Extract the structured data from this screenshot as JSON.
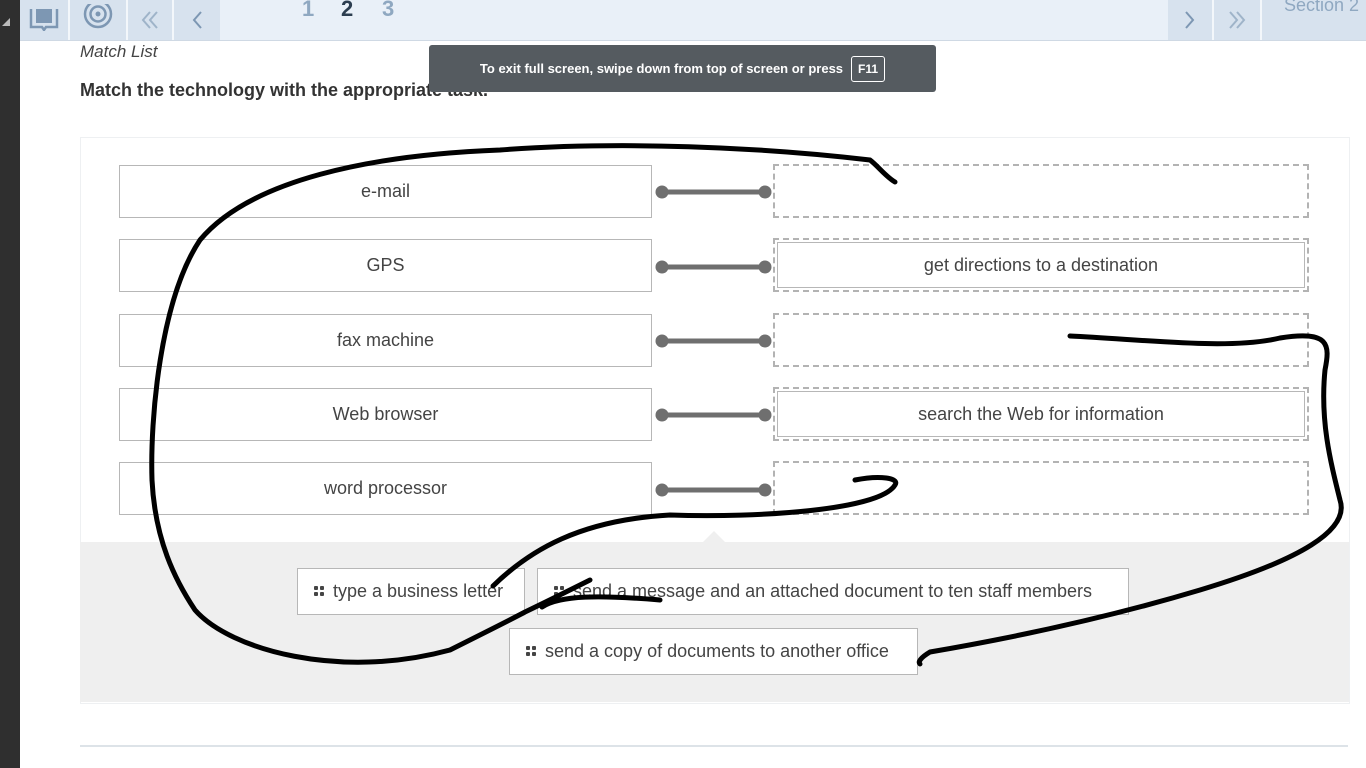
{
  "nav": {
    "pages": [
      "1",
      "2",
      "3"
    ],
    "current_page": "2",
    "section_label": "Section 2"
  },
  "question": {
    "type_label": "Match List",
    "instructions": "Match the technology with the appropriate task."
  },
  "fullscreen_toast": {
    "message": "To exit full screen, swipe down from top of screen or press",
    "key": "F11"
  },
  "terms": [
    "e-mail",
    "GPS",
    "fax machine",
    "Web browser",
    "word processor"
  ],
  "answers": [
    "",
    "get directions to a destination",
    "",
    "search the Web for information",
    ""
  ],
  "bank": {
    "chips": [
      "type a business letter",
      "send a message and an attached document to ten staff members",
      "send a copy of documents to another office"
    ]
  },
  "icons": {
    "nav": [
      "ebook-icon",
      "target-icon",
      "first-page-icon",
      "previous-page-icon",
      "next-page-icon",
      "last-page-icon"
    ],
    "chip": "grip-icon"
  },
  "colors": {
    "nav_bg": "#e9f0f8",
    "nav_button": "#d7e2ee",
    "connector": "#6f6f6f",
    "bank_bg": "#efefef",
    "toast_bg": "#555b60",
    "scribble": "#000000"
  }
}
